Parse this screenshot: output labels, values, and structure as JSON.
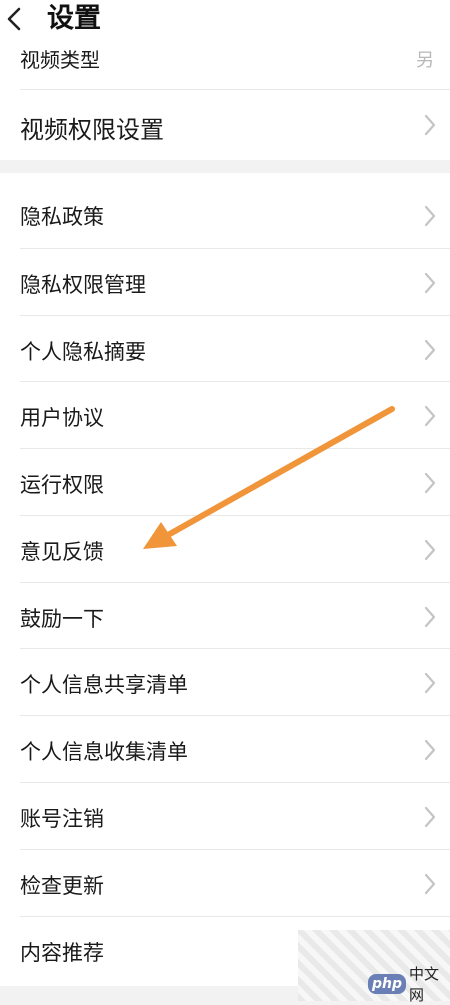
{
  "header": {
    "title": "设置"
  },
  "top_section": {
    "items": [
      {
        "label": "视频类型",
        "value": "另"
      },
      {
        "label": "视频权限设置"
      }
    ]
  },
  "main_section": {
    "items": [
      {
        "label": "隐私政策"
      },
      {
        "label": "隐私权限管理"
      },
      {
        "label": "个人隐私摘要"
      },
      {
        "label": "用户协议"
      },
      {
        "label": "运行权限"
      },
      {
        "label": "意见反馈"
      },
      {
        "label": "鼓励一下"
      },
      {
        "label": "个人信息共享清单"
      },
      {
        "label": "个人信息收集清单"
      },
      {
        "label": "账号注销"
      },
      {
        "label": "检查更新"
      },
      {
        "label": "内容推荐"
      }
    ]
  },
  "annotation": {
    "color": "#f0953a",
    "target": "意见反馈"
  },
  "watermark": {
    "badge": "php",
    "text": "中文网"
  }
}
